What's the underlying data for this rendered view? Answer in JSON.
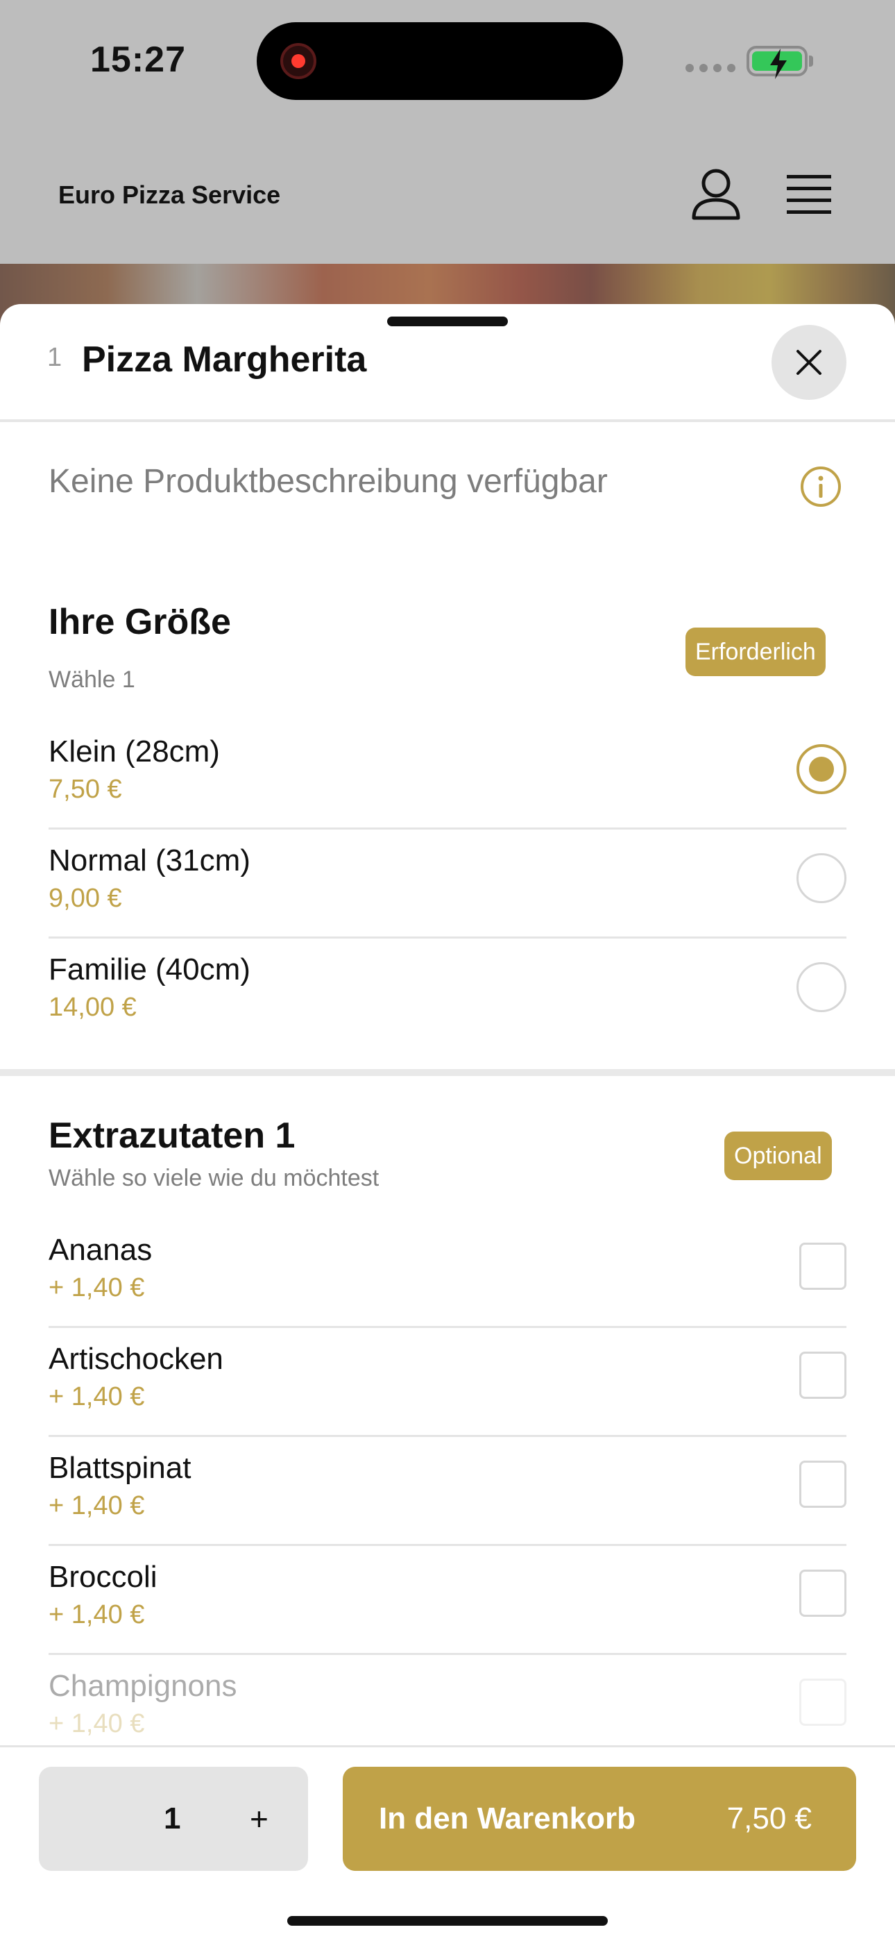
{
  "status_bar": {
    "time": "15:27",
    "battery_color": "#34c759"
  },
  "header": {
    "brand": "Euro Pizza Service",
    "user_icon": "user-icon",
    "menu_icon": "hamburger-menu-icon"
  },
  "sheet": {
    "item_number": "1",
    "item_title": "Pizza Margherita",
    "description": "Keine Produktbeschreibung verfügbar"
  },
  "size_section": {
    "title": "Ihre Größe",
    "subtitle": "Wähle 1",
    "badge": "Erforderlich",
    "options": [
      {
        "name": "Klein (28cm)",
        "price": "7,50 €",
        "selected": true
      },
      {
        "name": "Normal (31cm)",
        "price": "9,00 €",
        "selected": false
      },
      {
        "name": "Familie (40cm)",
        "price": "14,00 €",
        "selected": false
      }
    ]
  },
  "extras_section": {
    "title": "Extrazutaten 1",
    "subtitle": "Wähle so viele wie du möchtest",
    "badge": "Optional",
    "options": [
      {
        "name": "Ananas",
        "price": "+ 1,40 €"
      },
      {
        "name": "Artischocken",
        "price": "+ 1,40 €"
      },
      {
        "name": "Blattspinat",
        "price": "+ 1,40 €"
      },
      {
        "name": "Broccoli",
        "price": "+ 1,40 €"
      },
      {
        "name": "Champignons",
        "price": "+ 1,40 €"
      }
    ]
  },
  "bottom_bar": {
    "quantity": "1",
    "plus": "+",
    "cart_label": "In den Warenkorb",
    "cart_price": "7,50 €"
  },
  "colors": {
    "accent": "#c0a248",
    "overlay": "#bdbdbd"
  }
}
